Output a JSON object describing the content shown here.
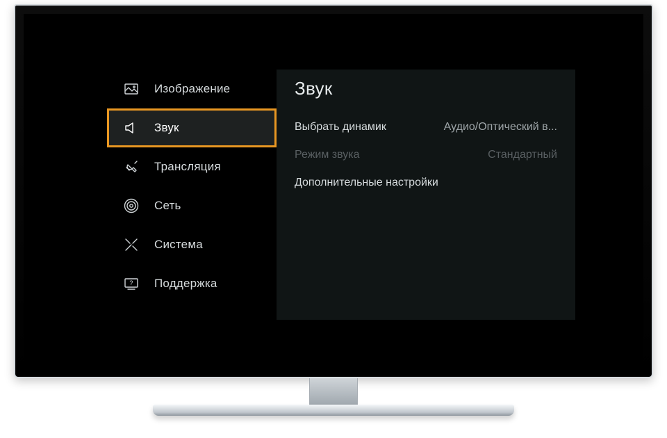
{
  "sidebar": {
    "items": [
      {
        "label": "Изображение"
      },
      {
        "label": "Звук"
      },
      {
        "label": "Трансляция"
      },
      {
        "label": "Сеть"
      },
      {
        "label": "Система"
      },
      {
        "label": "Поддержка"
      }
    ]
  },
  "panel": {
    "title": "Звук",
    "rows": [
      {
        "label": "Выбрать динамик",
        "value": "Аудио/Оптический в..."
      },
      {
        "label": "Режим звука",
        "value": "Стандартный"
      },
      {
        "label": "Дополнительные настройки",
        "value": ""
      }
    ]
  }
}
